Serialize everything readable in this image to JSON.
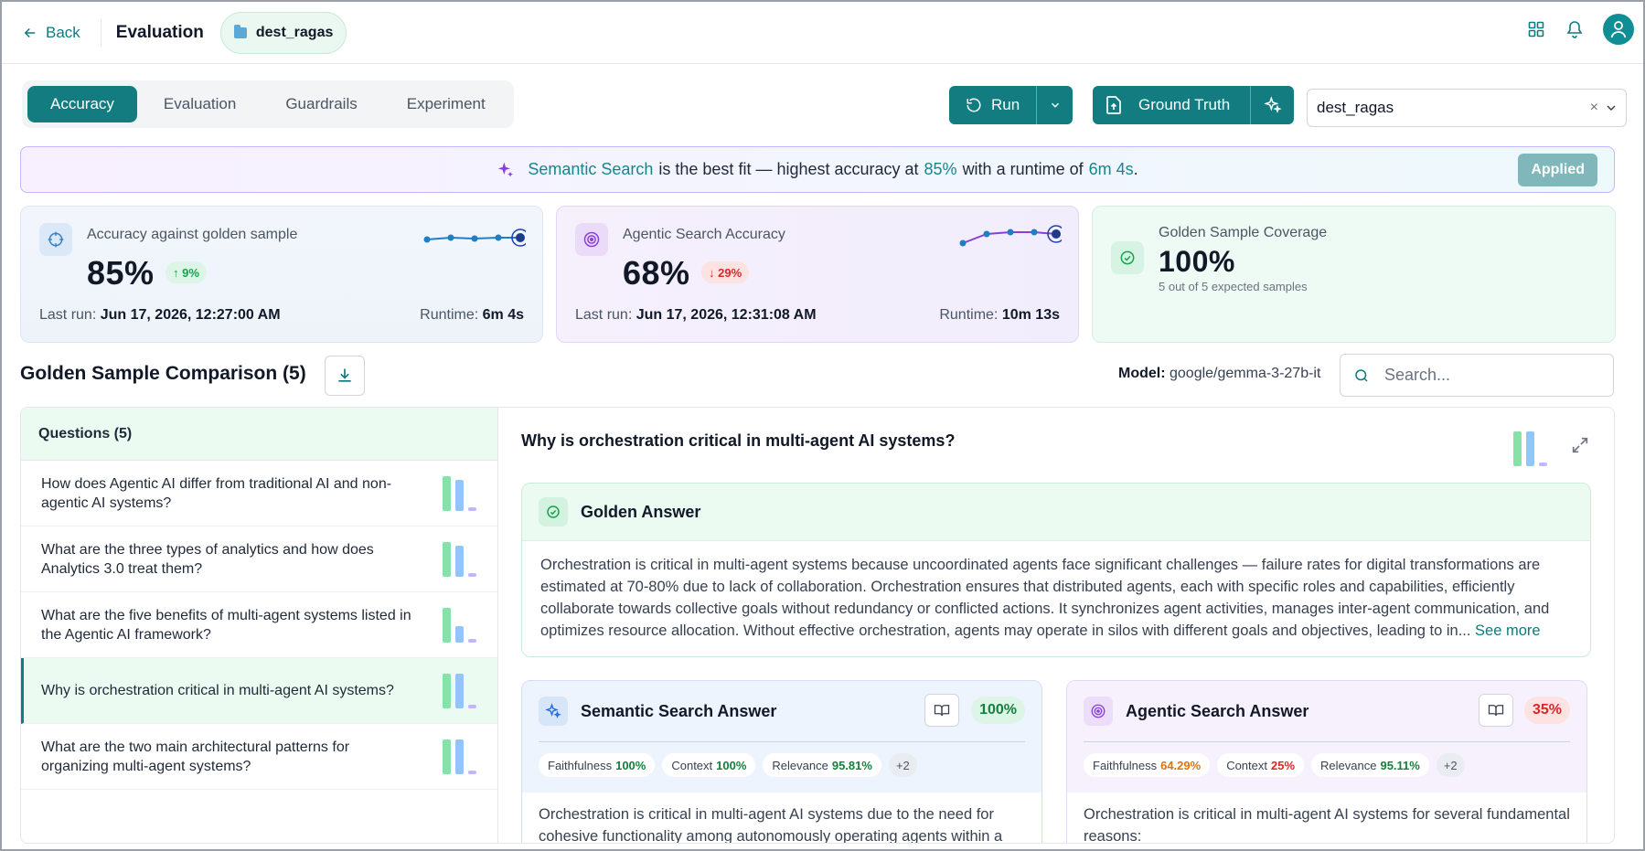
{
  "header": {
    "back_label": "Back",
    "title": "Evaluation",
    "dataset_chip": "dest_ragas"
  },
  "tabs": [
    "Accuracy",
    "Evaluation",
    "Guardrails",
    "Experiment"
  ],
  "toolbar": {
    "run_label": "Run",
    "ground_truth_label": "Ground Truth",
    "dataset_value": "dest_ragas",
    "clear_symbol": "×"
  },
  "banner": {
    "method": "Semantic Search",
    "text1": "is the best fit — highest accuracy at",
    "accuracy": "85%",
    "text2": "with a runtime of",
    "runtime": "6m 4s",
    "period": ".",
    "applied_label": "Applied"
  },
  "metrics": {
    "accuracy": {
      "label": "Accuracy against golden sample",
      "value": "85%",
      "delta": "↑ 9%",
      "last_run_label": "Last run:",
      "last_run": "Jun 17, 2026, 12:27:00 AM",
      "runtime_label": "Runtime:",
      "runtime": "6m 4s"
    },
    "agentic": {
      "label": "Agentic Search Accuracy",
      "value": "68%",
      "delta": "↓ 29%",
      "last_run_label": "Last run:",
      "last_run": "Jun 17, 2026, 12:31:08 AM",
      "runtime_label": "Runtime:",
      "runtime": "10m 13s"
    },
    "coverage": {
      "label": "Golden Sample Coverage",
      "value": "100%",
      "sub": "5 out of 5 expected samples"
    }
  },
  "comparison": {
    "title": "Golden Sample Comparison (5)",
    "model_label": "Model:",
    "model": "google/gemma-3-27b-it",
    "search_placeholder": "Search...",
    "questions_header": "Questions (5)",
    "questions": [
      "How does Agentic AI differ from traditional AI and non-agentic AI systems?",
      "What are the three types of analytics and how does Analytics 3.0 treat them?",
      "What are the five benefits of multi-agent systems listed in the Agentic AI framework?",
      "Why is orchestration critical in multi-agent AI systems?",
      "What are the two main architectural patterns for organizing multi-agent systems?"
    ],
    "selected_question": "Why is orchestration critical in multi-agent AI systems?"
  },
  "golden_answer": {
    "title": "Golden Answer",
    "text": "Orchestration is critical in multi-agent systems because uncoordinated agents face significant challenges — failure rates for digital transformations are estimated at 70-80% due to lack of collaboration. Orchestration ensures that distributed agents, each with specific roles and capabilities, efficiently collaborate towards collective goals without redundancy or conflicted actions. It synchronizes agent activities, manages inter-agent communication, and optimizes resource allocation. Without effective orchestration, agents may operate in silos with different goals and objectives, leading to in...",
    "see_more": "See more"
  },
  "semantic_answer": {
    "title": "Semantic Search Answer",
    "score": "100%",
    "faithfulness_label": "Faithfulness",
    "faithfulness": "100%",
    "context_label": "Context",
    "context": "100%",
    "relevance_label": "Relevance",
    "relevance": "95.81%",
    "more": "+2",
    "text": "Orchestration is critical in multi-agent AI systems due to the need for cohesive functionality among autonomously operating agents within a"
  },
  "agentic_answer": {
    "title": "Agentic Search Answer",
    "score": "35%",
    "faithfulness_label": "Faithfulness",
    "faithfulness": "64.29%",
    "context_label": "Context",
    "context": "25%",
    "relevance_label": "Relevance",
    "relevance": "95.11%",
    "more": "+2",
    "text": "Orchestration is critical in multi-agent AI systems for several fundamental reasons:"
  },
  "colors": {
    "accent": "#127c80",
    "golden_green": "#86e2a8",
    "semantic_blue": "#93c5fd",
    "agentic_purple": "#c4b5fd"
  }
}
